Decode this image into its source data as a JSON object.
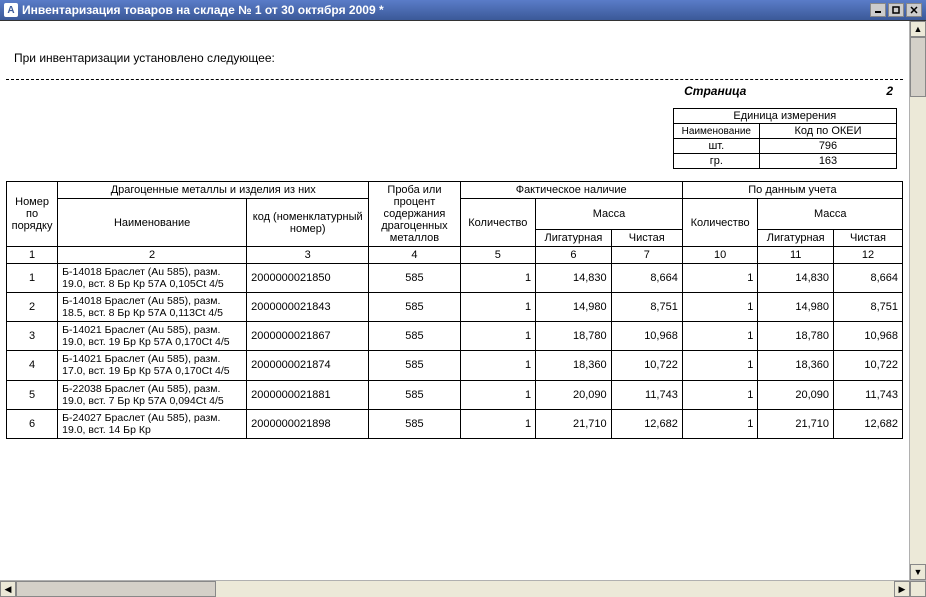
{
  "window": {
    "title": "Инвентаризация товаров на складе № 1 от 30 октября 2009 *"
  },
  "intro_text": "При инвентаризации установлено следующее:",
  "page_label": "Страница",
  "page_number": "2",
  "unit_box": {
    "caption": "Единица измерения",
    "name_label": "Наименование",
    "okei_label": "Код по ОКЕИ",
    "rows": [
      {
        "name": "шт.",
        "code": "796"
      },
      {
        "name": "гр.",
        "code": "163"
      }
    ]
  },
  "headers": {
    "no": "Номер по порядку",
    "metals_group": "Драгоценные металлы и изделия из них",
    "name": "Наименование",
    "code": "код (номенклатурный номер)",
    "proba": "Проба или процент содержания драгоценных металлов",
    "actual_group": "Фактическое наличие",
    "ledger_group": "По данным учета",
    "qty": "Количество",
    "mass": "Масса",
    "ligature": "Лигатурная",
    "pure": "Чистая",
    "colnums": {
      "c1": "1",
      "c2": "2",
      "c3": "3",
      "c4": "4",
      "c5": "5",
      "c6": "6",
      "c7": "7",
      "c10": "10",
      "c11": "11",
      "c12": "12"
    }
  },
  "rows": [
    {
      "no": "1",
      "name": "Б-14018 Браслет (Au 585), разм. 19.0, вст. 8 Бр Кр 57А 0,105Ct 4/5",
      "code": "2000000021850",
      "proba": "585",
      "qtyA": "1",
      "ligA": "14,830",
      "pureA": "8,664",
      "qtyB": "1",
      "ligB": "14,830",
      "pureB": "8,664"
    },
    {
      "no": "2",
      "name": "Б-14018 Браслет (Au 585), разм. 18.5, вст. 8 Бр Кр 57А 0,113Ct 4/5",
      "code": "2000000021843",
      "proba": "585",
      "qtyA": "1",
      "ligA": "14,980",
      "pureA": "8,751",
      "qtyB": "1",
      "ligB": "14,980",
      "pureB": "8,751"
    },
    {
      "no": "3",
      "name": "Б-14021 Браслет (Au 585), разм. 19.0, вст. 19 Бр Кр 57А 0,170Ct 4/5",
      "code": "2000000021867",
      "proba": "585",
      "qtyA": "1",
      "ligA": "18,780",
      "pureA": "10,968",
      "qtyB": "1",
      "ligB": "18,780",
      "pureB": "10,968"
    },
    {
      "no": "4",
      "name": "Б-14021 Браслет (Au 585), разм. 17.0, вст. 19 Бр Кр 57А 0,170Ct 4/5",
      "code": "2000000021874",
      "proba": "585",
      "qtyA": "1",
      "ligA": "18,360",
      "pureA": "10,722",
      "qtyB": "1",
      "ligB": "18,360",
      "pureB": "10,722"
    },
    {
      "no": "5",
      "name": "Б-22038 Браслет (Au 585), разм. 19.0, вст. 7 Бр Кр 57А 0,094Ct 4/5",
      "code": "2000000021881",
      "proba": "585",
      "qtyA": "1",
      "ligA": "20,090",
      "pureA": "11,743",
      "qtyB": "1",
      "ligB": "20,090",
      "pureB": "11,743"
    },
    {
      "no": "6",
      "name": "Б-24027 Браслет (Au 585), разм. 19.0, вст. 14 Бр Кр",
      "code": "2000000021898",
      "proba": "585",
      "qtyA": "1",
      "ligA": "21,710",
      "pureA": "12,682",
      "qtyB": "1",
      "ligB": "21,710",
      "pureB": "12,682"
    }
  ]
}
